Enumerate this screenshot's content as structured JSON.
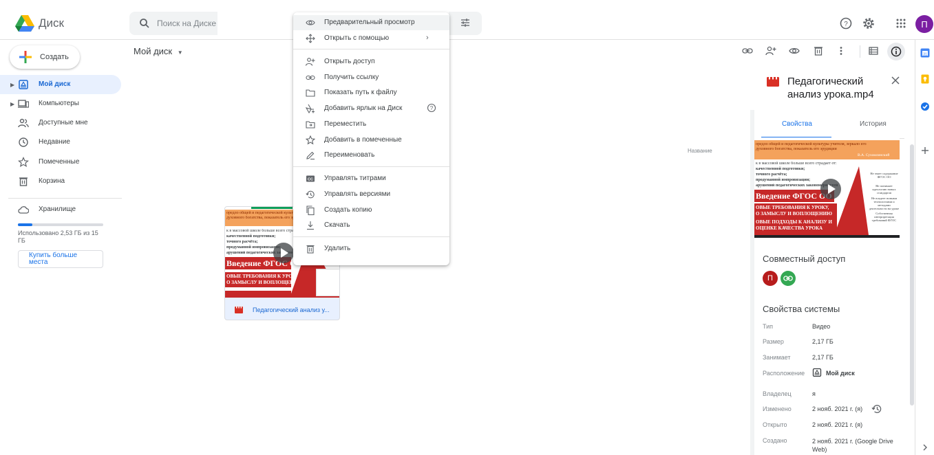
{
  "app": {
    "name": "Диск"
  },
  "search": {
    "placeholder": "Поиск на Диске"
  },
  "account": {
    "initial": "П"
  },
  "sidebar": {
    "create_label": "Создать",
    "items": [
      {
        "label": "Мой диск",
        "icon": "my-drive-icon",
        "active": true
      },
      {
        "label": "Компьютеры",
        "icon": "computer-icon"
      },
      {
        "label": "Доступные мне",
        "icon": "shared-icon"
      },
      {
        "label": "Недавние",
        "icon": "clock-icon"
      },
      {
        "label": "Помеченные",
        "icon": "star-icon"
      },
      {
        "label": "Корзина",
        "icon": "trash-icon"
      }
    ],
    "storage_label": "Хранилище",
    "storage_used": "Использовано 2,53 ГБ из 15 ГБ",
    "storage_fraction": 0.17,
    "buy_more": "Купить больше места"
  },
  "main": {
    "breadcrumb": "Мой диск",
    "column_header": "Название",
    "file_tile_name": "Педагогический анализ у..."
  },
  "context_menu": {
    "items": [
      {
        "label": "Предварительный просмотр",
        "icon": "eye-icon"
      },
      {
        "label": "Открыть с помощью",
        "icon": "move-arrows-icon"
      },
      {
        "label": "Открыть доступ",
        "icon": "add-person-icon"
      },
      {
        "label": "Получить ссылку",
        "icon": "link-icon"
      },
      {
        "label": "Показать путь к файлу",
        "icon": "folder-icon"
      },
      {
        "label": "Добавить ярлык на Диск",
        "icon": "shortcut-icon"
      },
      {
        "label": "Переместить",
        "icon": "move-icon"
      },
      {
        "label": "Добавить в помеченные",
        "icon": "star-icon"
      },
      {
        "label": "Переименовать",
        "icon": "pencil-icon"
      },
      {
        "label": "Управлять титрами",
        "icon": "cc-icon"
      },
      {
        "label": "Управлять версиями",
        "icon": "history-icon"
      },
      {
        "label": "Создать копию",
        "icon": "copy-icon"
      },
      {
        "label": "Скачать",
        "icon": "download-icon"
      },
      {
        "label": "Удалить",
        "icon": "trash-icon"
      }
    ]
  },
  "details": {
    "file_title": "Педагогический анализ урока.mp4",
    "tabs": [
      "Свойства",
      "История"
    ],
    "sharing_title": "Совместный доступ",
    "sharing_initial": "П",
    "system_title": "Свойства системы",
    "properties": [
      {
        "key": "Тип",
        "value": "Видео"
      },
      {
        "key": "Размер",
        "value": "2,17 ГБ"
      },
      {
        "key": "Занимает",
        "value": "2,17 ГБ"
      },
      {
        "key": "Расположение",
        "value": "Мой диск"
      },
      {
        "key": "Владелец",
        "value": "я"
      },
      {
        "key": "Изменено",
        "value": "2 нояб. 2021 г. (я)"
      },
      {
        "key": "Открыто",
        "value": "2 нояб. 2021 г. (я)"
      },
      {
        "key": "Создано",
        "value": "2 нояб. 2021 г. (Google Drive Web)"
      }
    ]
  },
  "thumbnail": {
    "line1": "оредло общей и педагогической культуры учителя, зеркало его",
    "line2": "духовного богатства, показатель его эрудиции",
    "line3": "к в массовой школе больше всего страдает от:",
    "line4": "качественной подготовки;",
    "line5": "точного расчёта;",
    "line6": "продуманной импровизации;",
    "line7": "арушений педагогических закономерностей",
    "author": "В.А. Сухомлинский",
    "banner": "Введение ФГОС ОО",
    "req1": "ОВЫЕ ТРЕБОВАНИЯ К УРОКУ,",
    "req2": "О ЗАМЫСЛУ И ВОПЛОЩЕНИЮ",
    "req3": "ОВЫЕ ПОДХОДЫ К АНАЛИЗУ И",
    "req4": "ОЦЕНКЕ КАЧЕСТВА УРОКА",
    "side1": "Не знает содержание ФГОС ОО",
    "side2": "Не понимает идеологию новых стандартов",
    "side3": "Не владеет новыми технологиями и методами деятельности на уроке",
    "side4": "Собственная интерпретация требований ФГОС"
  },
  "colors": {
    "accent": "#1a73e8",
    "active_bg": "#e8f0fe",
    "video_red": "#d93025"
  }
}
